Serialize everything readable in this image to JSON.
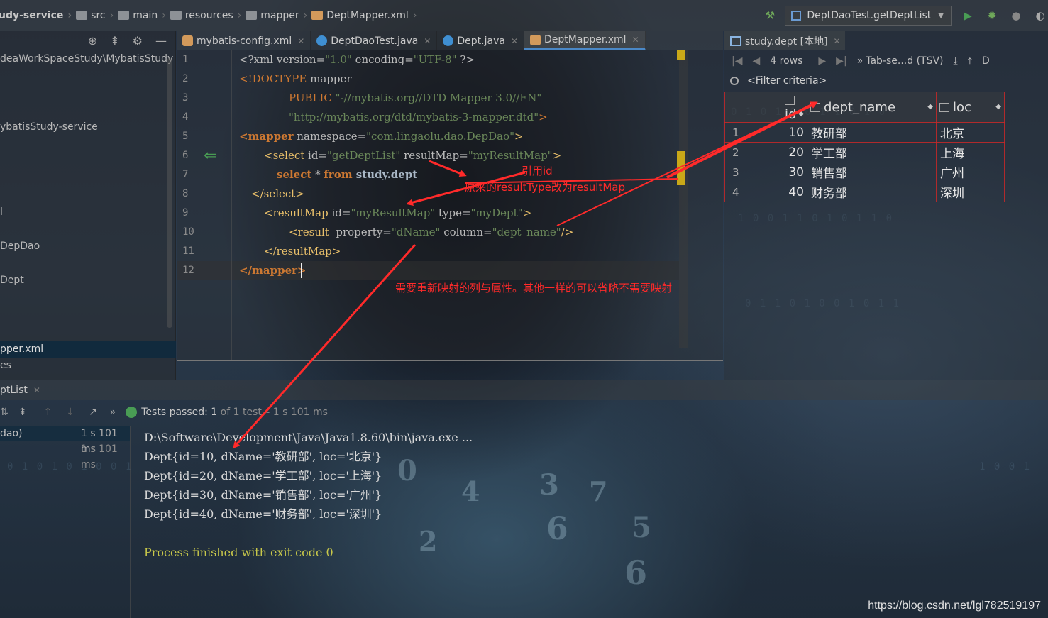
{
  "breadcrumb": [
    "udy-service",
    "src",
    "main",
    "resources",
    "mapper",
    "DeptMapper.xml"
  ],
  "run_config": "DeptDaoTest.getDeptList",
  "project": {
    "items": [
      {
        "label": "deaWorkSpaceStudy\\MybatisStudy",
        "selected": false
      },
      {
        "label": "ybatisStudy-service",
        "selected": false
      },
      {
        "label": "l",
        "selected": false
      },
      {
        "label": "DepDao",
        "selected": false
      },
      {
        "label": "Dept",
        "selected": false
      },
      {
        "label": "pper.xml",
        "selected": true
      },
      {
        "label": "es",
        "selected": false
      }
    ]
  },
  "editor": {
    "tabs": [
      {
        "label": "mybatis-config.xml",
        "icon": "xml-file-icon"
      },
      {
        "label": "DeptDaoTest.java",
        "icon": "java-class-icon"
      },
      {
        "label": "Dept.java",
        "icon": "java-class-icon"
      },
      {
        "label": "DeptMapper.xml",
        "icon": "xml-file-icon",
        "active": true
      }
    ],
    "line_numbers": [
      "1",
      "2",
      "3",
      "4",
      "5",
      "6",
      "7",
      "8",
      "9",
      "10",
      "11",
      "12"
    ],
    "lines": {
      "l1": {
        "a": "<?xml version=",
        "b": "\"1.0\"",
        "c": " encoding=",
        "d": "\"UTF-8\"",
        "e": " ?>"
      },
      "l2": {
        "a": "<!DOCTYPE",
        "b": " mapper"
      },
      "l3": {
        "a": "PUBLIC",
        "b": " \"-//mybatis.org//DTD Mapper 3.0//EN\""
      },
      "l4": {
        "a": "\"http://mybatis.org/dtd/mybatis-3-mapper.dtd\"",
        "b": ">"
      },
      "l5": {
        "a": "<mapper",
        "b": " namespace=",
        "c": "\"com.lingaolu.dao.DepDao\"",
        "d": ">"
      },
      "l6": {
        "a": "<select",
        "b": " id=",
        "c": "\"getDeptList\"",
        "d": " resultMap=",
        "e": "\"myResultMap\"",
        "f": ">"
      },
      "l7": {
        "a": "select",
        "b": " * ",
        "c": "from",
        "d": " study.dept"
      },
      "l8": {
        "a": "</select>"
      },
      "l9": {
        "a": "<resultMap",
        "b": " id=",
        "c": "\"myResultMap\"",
        "d": " type=",
        "e": "\"myDept\"",
        "f": ">"
      },
      "l10": {
        "a": "<result",
        "b": "  property=",
        "c": "\"dName\"",
        "d": " column=",
        "e": "\"dept_name\"",
        "f": "/>"
      },
      "l11": {
        "a": "</resultMap>"
      },
      "l12": {
        "a": "</mapper>"
      }
    }
  },
  "db": {
    "tab_label": "study.dept [本地]",
    "rows_label": "4 rows",
    "export_label": "Tab-se...d (TSV)",
    "filter_label": "<Filter criteria>",
    "columns": [
      "id",
      "dept_name",
      "loc"
    ],
    "rows": [
      {
        "n": "1",
        "id": "10",
        "dept_name": "教研部",
        "loc": "北京"
      },
      {
        "n": "2",
        "id": "20",
        "dept_name": "学工部",
        "loc": "上海"
      },
      {
        "n": "3",
        "id": "30",
        "dept_name": "销售部",
        "loc": "广州"
      },
      {
        "n": "4",
        "id": "40",
        "dept_name": "财务部",
        "loc": "深圳"
      }
    ]
  },
  "run": {
    "tab_label": "ptList",
    "tests_passed": "Tests passed:",
    "tests_count": "1",
    "tests_of": "of 1 test",
    "tests_time": "1 s 101 ms",
    "tree": [
      {
        "label": "dao)",
        "time": "1 s 101 ms"
      },
      {
        "label": "",
        "time": "1 s 101 ms"
      }
    ],
    "console": [
      "D:\\Software\\Development\\Java\\Java1.8.60\\bin\\java.exe ...",
      "Dept{id=10, dName='教研部', loc='北京'}",
      "Dept{id=20, dName='学工部', loc='上海'}",
      "Dept{id=30, dName='销售部', loc='广州'}",
      "Dept{id=40, dName='财务部', loc='深圳'}",
      "",
      "Process finished with exit code 0"
    ]
  },
  "annotations": {
    "ref_id": "引用id",
    "changed": "原来的resultType改为resultMap",
    "remap": "需要重新映射的列与属性。其他一样的可以省略不需要映射"
  },
  "watermark": "https://blog.csdn.net/lgl782519197",
  "colors": {
    "annotation": "#ff2a2a",
    "tag": "#e8bf6a",
    "string": "#6a8759",
    "keyword": "#cc7832"
  }
}
